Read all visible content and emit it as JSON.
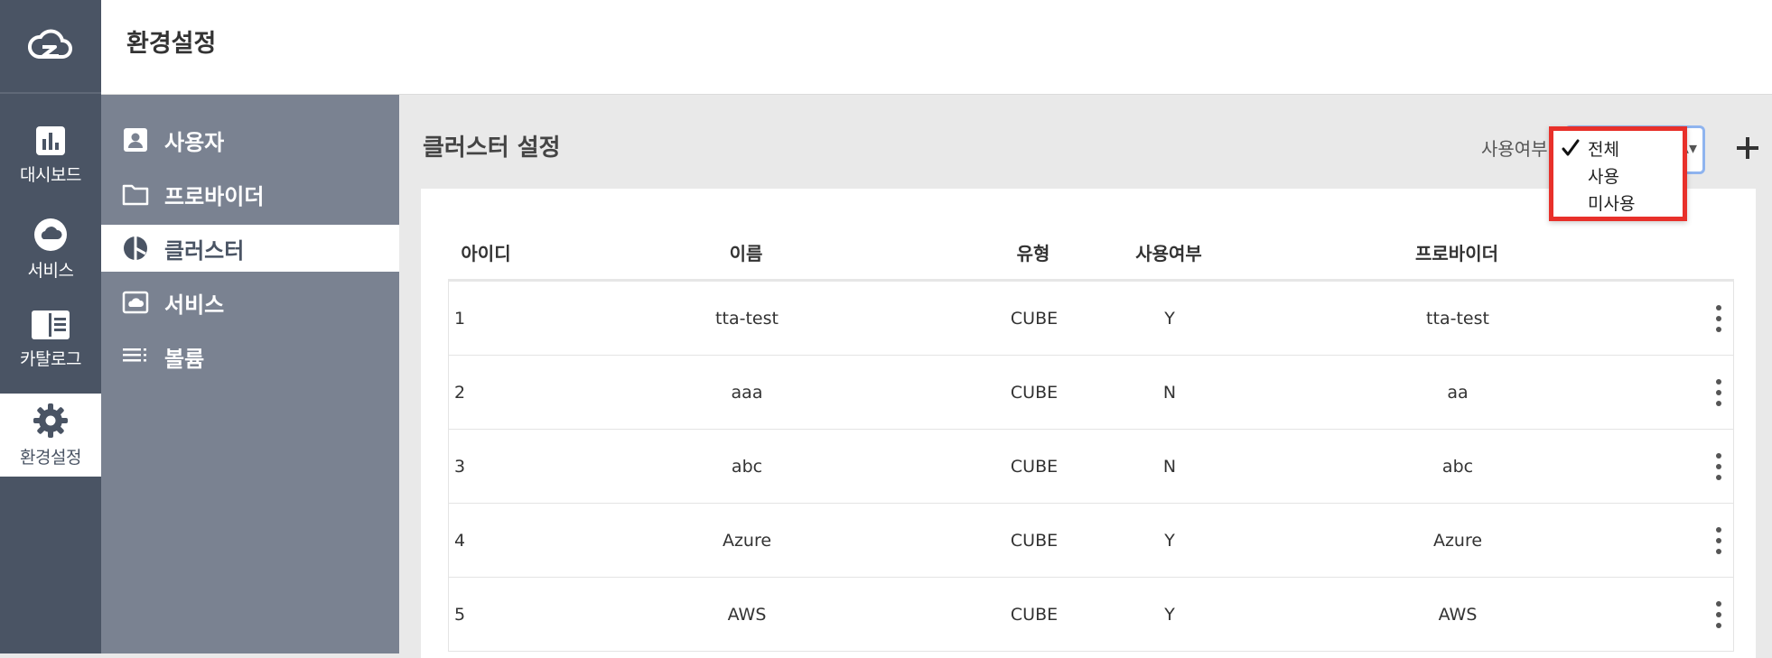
{
  "rail": {
    "items": [
      {
        "label": "대시보드",
        "icon": "bar-chart-icon"
      },
      {
        "label": "서비스",
        "icon": "cloud-icon"
      },
      {
        "label": "카탈로그",
        "icon": "catalog-icon"
      },
      {
        "label": "환경설정",
        "icon": "gear-icon"
      }
    ],
    "active_index": 3
  },
  "header": {
    "title": "환경설정"
  },
  "subnav": {
    "items": [
      {
        "label": "사용자",
        "icon": "user-icon"
      },
      {
        "label": "프로바이더",
        "icon": "folder-icon"
      },
      {
        "label": "클러스터",
        "icon": "cluster-icon"
      },
      {
        "label": "서비스",
        "icon": "service-icon"
      },
      {
        "label": "볼륨",
        "icon": "volume-icon"
      }
    ],
    "active_index": 2
  },
  "main": {
    "section_title": "클러스터 설정",
    "filter": {
      "label": "사용여부",
      "options": [
        "전체",
        "사용",
        "미사용"
      ],
      "selected": "전체"
    },
    "table": {
      "headers": [
        "아이디",
        "이름",
        "유형",
        "사용여부",
        "프로바이더"
      ],
      "rows": [
        {
          "id": "1",
          "name": "tta-test",
          "type": "CUBE",
          "enabled": "Y",
          "provider": "tta-test"
        },
        {
          "id": "2",
          "name": "aaa",
          "type": "CUBE",
          "enabled": "N",
          "provider": "aa"
        },
        {
          "id": "3",
          "name": "abc",
          "type": "CUBE",
          "enabled": "N",
          "provider": "abc"
        },
        {
          "id": "4",
          "name": "Azure",
          "type": "CUBE",
          "enabled": "Y",
          "provider": "Azure"
        },
        {
          "id": "5",
          "name": "AWS",
          "type": "CUBE",
          "enabled": "Y",
          "provider": "AWS"
        }
      ]
    }
  },
  "colors": {
    "rail_bg": "#4a5464",
    "subnav_bg": "#7a8291",
    "highlight_border": "#e8302a"
  }
}
